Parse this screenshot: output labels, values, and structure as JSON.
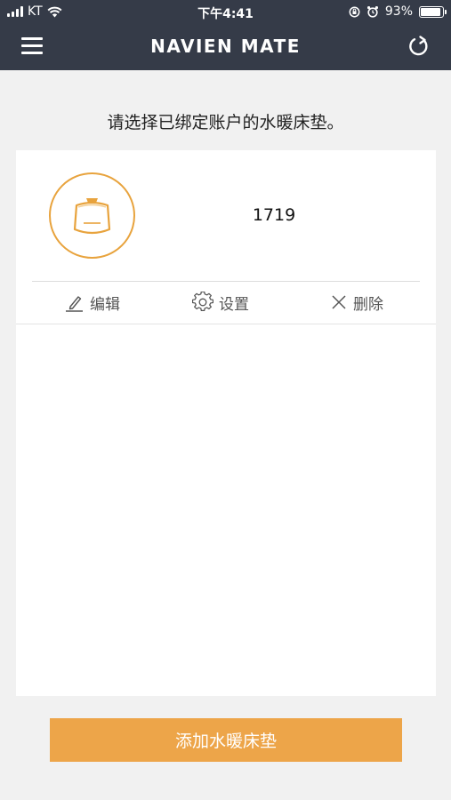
{
  "status_bar": {
    "carrier": "KT",
    "time": "下午4:41",
    "battery_text": "93%",
    "battery_level": 0.93
  },
  "header": {
    "title": "NAVIEN MATE",
    "menu_icon": "hamburger-menu-icon",
    "refresh_icon": "refresh-icon"
  },
  "prompt": "请选择已绑定账户的水暖床垫。",
  "device": {
    "name": "1719",
    "icon": "boiler-device-icon"
  },
  "actions": {
    "edit_label": "编辑",
    "settings_label": "设置",
    "delete_label": "删除"
  },
  "add_button_label": "添加水暖床垫",
  "colors": {
    "header_bg": "#353b48",
    "accent": "#eda549",
    "page_bg": "#f1f1f1"
  }
}
